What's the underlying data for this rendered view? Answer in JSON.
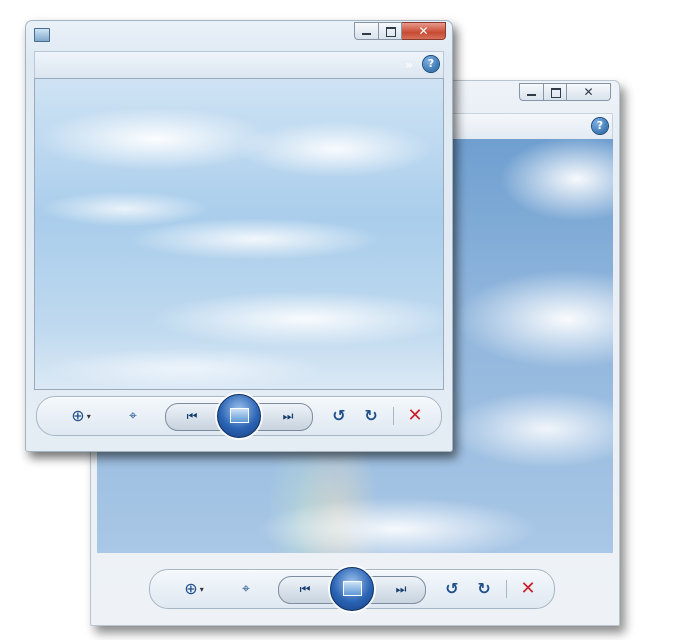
{
  "windows": [
    {
      "id": "back",
      "caption_buttons": {
        "minimize_icon": "minimize-icon",
        "maximize_icon": "maximize-icon",
        "close_icon": "close-icon",
        "close_glyph": "✕"
      },
      "help_glyph": "?",
      "image_content": "sky-with-cumulus-clouds",
      "toolbar": {
        "zoom_glyph": "⊕",
        "zoom_arrow": "▾",
        "fit_glyph": "⌖",
        "prev_glyph": "⏮",
        "next_glyph": "⏭",
        "rotate_left_glyph": "↺",
        "rotate_right_glyph": "↻",
        "delete_glyph": "✕"
      }
    },
    {
      "id": "front",
      "caption_buttons": {
        "minimize_icon": "minimize-icon",
        "maximize_icon": "maximize-icon",
        "close_icon": "close-icon",
        "close_glyph": "✕"
      },
      "chevron_glyph": "»",
      "help_glyph": "?",
      "image_content": "light-blue-sky-with-wispy-clouds",
      "toolbar": {
        "zoom_glyph": "⊕",
        "zoom_arrow": "▾",
        "fit_glyph": "⌖",
        "prev_glyph": "⏮",
        "next_glyph": "⏭",
        "rotate_left_glyph": "↺",
        "rotate_right_glyph": "↻",
        "delete_glyph": "✕"
      }
    }
  ],
  "colors": {
    "close_button_red": "#c84a33",
    "delete_red": "#c8202a",
    "accent_blue": "#2b64b4"
  }
}
